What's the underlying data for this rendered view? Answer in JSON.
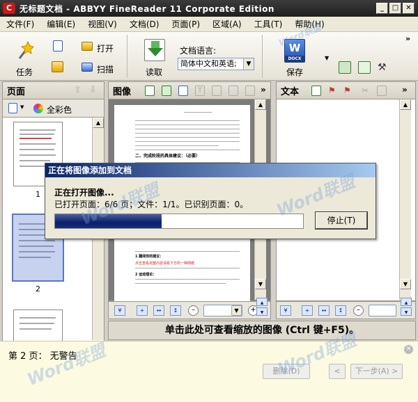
{
  "window": {
    "title": "无标题文档 - ABBYY FineReader 11 Corporate Edition",
    "icon_label": "C"
  },
  "menu": [
    "文件(F)",
    "编辑(E)",
    "视图(V)",
    "文档(D)",
    "页面(P)",
    "区域(A)",
    "工具(T)",
    "帮助(H)"
  ],
  "toolbar": {
    "task": "任务",
    "open": "打开",
    "scan": "扫描",
    "read": "读取",
    "doc_lang_label": "文档语言:",
    "doc_lang_value": "简体中文和英语;",
    "save": "保存",
    "docx_badge": "DOCX"
  },
  "panels": {
    "pages": "页面",
    "image": "图像",
    "text": "文本",
    "color_mode": "全彩色"
  },
  "thumbnails": [
    "1",
    "2"
  ],
  "doc_text": {
    "heading": "二、完成阶段的具体建议：（必要）",
    "red1": "点击查看完整内容请看下方的一种网络",
    "label1": "1 翻阅你的建议：",
    "label2": "2 运动理论："
  },
  "zoom_bar": "单击此处可查看缩放的图像 (Ctrl 键+F5)。",
  "dialog": {
    "title": "正在将图像添加到文档",
    "status": "正在打开图像...",
    "detail": "已打开页面：6/6 页；文件：1/1。已识别页面：0。",
    "stop": "停止(T)",
    "progress_percent": 43
  },
  "status": {
    "message": "第 2 页： 无警告",
    "delete": "删除(D)",
    "prev": "<",
    "next": "下一步(A) >"
  },
  "watermark": "Word联盟"
}
